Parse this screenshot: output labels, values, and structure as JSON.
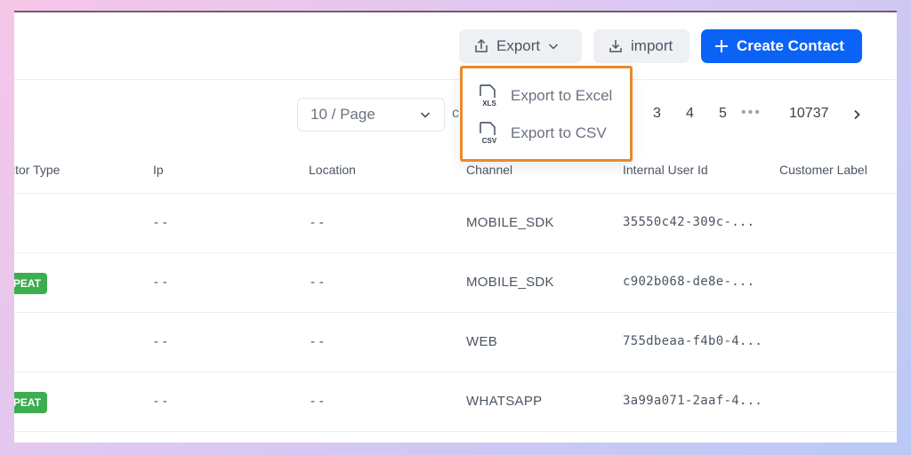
{
  "toolbar": {
    "export_label": "Export",
    "import_label": "import",
    "create_label": "Create Contact"
  },
  "export_menu": {
    "items": [
      {
        "label": "Export to Excel",
        "icon_text": "XLS"
      },
      {
        "label": "Export to CSV",
        "icon_text": "CSV"
      }
    ]
  },
  "pagination": {
    "page_size": "10 / Page",
    "partial_text": "c",
    "pages": [
      "3",
      "4",
      "5"
    ],
    "last_page": "10737"
  },
  "table": {
    "columns": [
      "itor Type",
      "Ip",
      "Location",
      "Channel",
      "Internal User Id",
      "Customer Label"
    ],
    "rows": [
      {
        "badge": "",
        "ip": "- -",
        "location": "- -",
        "channel": "MOBILE_SDK",
        "user_id": "35550c42-309c-..."
      },
      {
        "badge": "EPEAT",
        "ip": "- -",
        "location": "- -",
        "channel": "MOBILE_SDK",
        "user_id": "c902b068-de8e-..."
      },
      {
        "badge": "",
        "ip": "- -",
        "location": "- -",
        "channel": "WEB",
        "user_id": "755dbeaa-f4b0-4..."
      },
      {
        "badge": "EPEAT",
        "ip": "- -",
        "location": "- -",
        "channel": "WHATSAPP",
        "user_id": "3a99a071-2aaf-4..."
      }
    ]
  },
  "colors": {
    "primary": "#0b63f6",
    "badge_green": "#3dae4f",
    "highlight_orange": "#e8892b"
  }
}
